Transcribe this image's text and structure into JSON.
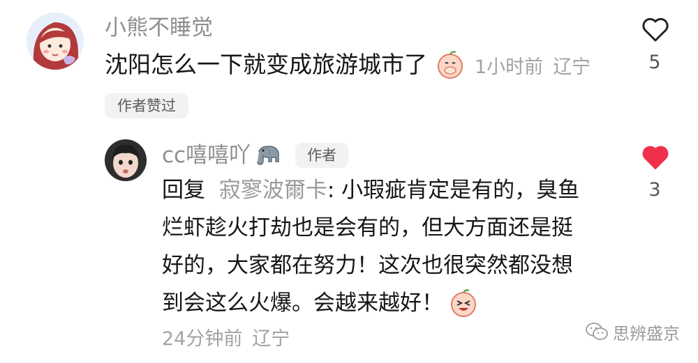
{
  "comment": {
    "username": "小熊不睡觉",
    "text": "沈阳怎么一下就变成旅游城市了",
    "time": "1小时前",
    "location": "辽宁",
    "badge": "作者赞过",
    "likes": "5",
    "liked": false,
    "avatar_icon": "girl-avatar",
    "emoji_icon": "peach-cover-mouth-emoji"
  },
  "reply": {
    "username": "cc嘻嘻吖",
    "username_emoji_icon": "elephant-icon",
    "author_tag": "作者",
    "prefix": "回复",
    "reply_to": "寂寥波爾卡",
    "text_lines": [
      ": 小瑕疵肯定是有的，臭鱼",
      "烂虾趁火打劫也是会有的，但大方面还是挺",
      "好的，大家都在努力！这次也很突然都没想",
      "到会这么火爆。会越来越好！"
    ],
    "time": "24分钟前",
    "location": "辽宁",
    "likes": "3",
    "liked": true,
    "accent_color": "#f0304a",
    "avatar_icon": "face-avatar",
    "emoji_icon": "peach-laughing-emoji"
  },
  "watermark": {
    "text": "思辨盛京",
    "icon": "wechat-icon"
  }
}
